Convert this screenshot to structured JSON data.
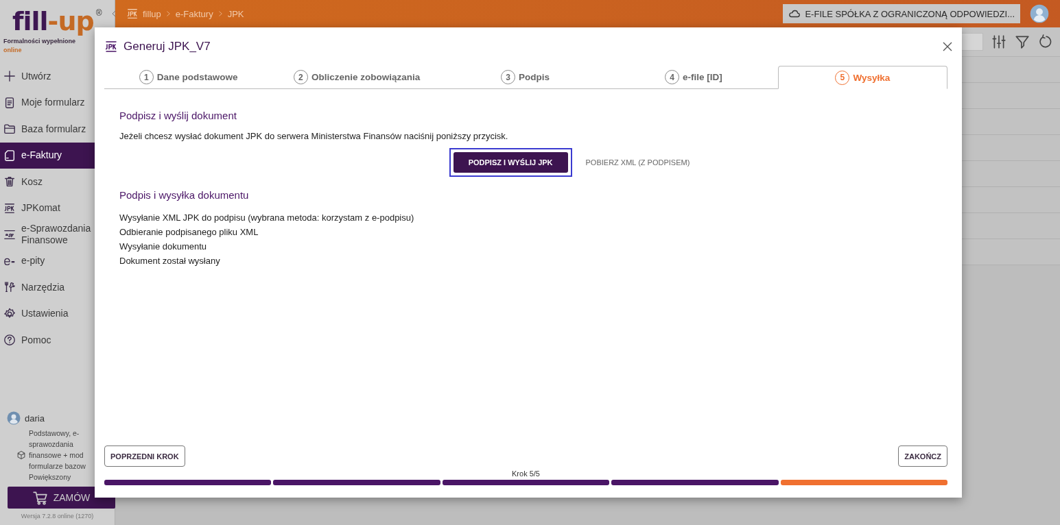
{
  "sidebar": {
    "logo": {
      "left": "fill",
      "right": "-up",
      "mark": "®"
    },
    "tagline": "Formalności wypełnione",
    "tagline_accent": "online",
    "items": [
      {
        "label": "Utwórz",
        "selected": false
      },
      {
        "label": "Moje formularz",
        "selected": false
      },
      {
        "label": "Baza formularz",
        "selected": false
      },
      {
        "label": "e-Faktury",
        "selected": true
      },
      {
        "label": "Kosz",
        "selected": false
      },
      {
        "label": "JPKomat",
        "selected": false
      },
      {
        "label": "e-Sprawozdania Finansowe",
        "selected": false
      },
      {
        "label": "e-pity",
        "selected": false
      },
      {
        "label": "Narzędzia",
        "selected": false
      },
      {
        "label": "Ustawienia",
        "selected": false
      },
      {
        "label": "Pomoc",
        "selected": false
      }
    ],
    "user": {
      "name": "daria",
      "plan": [
        "Podstawowy, e-",
        "sprawozdania",
        "finansowe + mod",
        "formularze bazow",
        "Powiększony"
      ]
    },
    "order_button": "ZAMÓW",
    "version": "Wersja 7.2.8 online (1270)"
  },
  "topbar": {
    "breadcrumb": [
      "fillup",
      "e-Faktury",
      "JPK"
    ],
    "company": "E-FILE SPÓŁKA Z OGRANICZONĄ ODPOWIEDZI..."
  },
  "dialog": {
    "title": "Generuj JPK_V7",
    "tabs": [
      {
        "number": "1",
        "label": "Dane podstawowe",
        "selected": false
      },
      {
        "number": "2",
        "label": "Obliczenie zobowiązania",
        "selected": false
      },
      {
        "number": "3",
        "label": "Podpis",
        "selected": false
      },
      {
        "number": "4",
        "label": "e-file [ID]",
        "selected": false
      },
      {
        "number": "5",
        "label": "Wysyłka",
        "selected": true
      }
    ],
    "section_title": "Podpisz i wyślij dokument",
    "instruction": "Jeżeli chcesz wysłać dokument JPK do serwera Ministerstwa Finansów naciśnij poniższy przycisk.",
    "primary_button": {
      "label": "PODPISZ I WYŚLIJ JPK",
      "focused": true
    },
    "secondary_link": "POBIERZ XML (Z PODPISEM)",
    "log_title": "Podpis i wysyłka dokumentu",
    "log": [
      "Wysyłanie XML JPK do podpisu (wybrana metoda: korzystam z e-podpisu)",
      "Odbieranie podpisanego pliku XML",
      "Wysyłanie dokumentu",
      "Dokument został wysłany"
    ],
    "back_button": "POPRZEDNI KROK",
    "finish_button": "ZAKOŃCZ",
    "step_label": "Krok 5/5",
    "progress": [
      {
        "current": false
      },
      {
        "current": false
      },
      {
        "current": false
      },
      {
        "current": false
      },
      {
        "current": true
      }
    ]
  }
}
